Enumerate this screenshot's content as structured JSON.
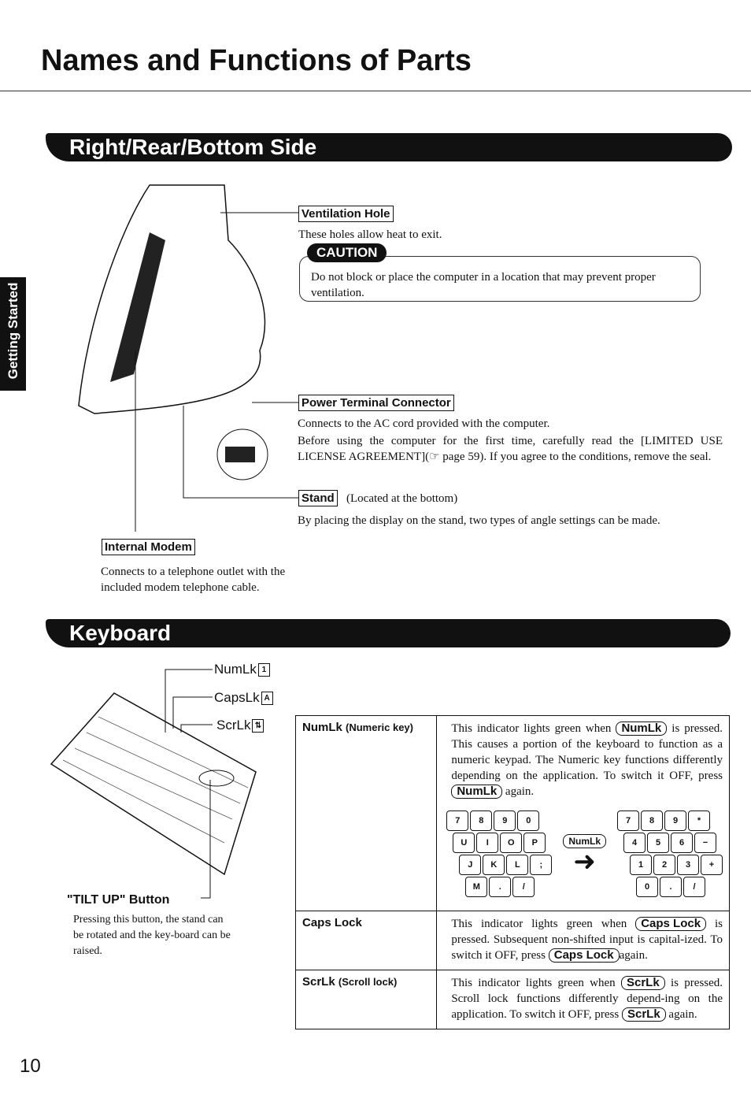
{
  "title": "Names and Functions of Parts",
  "side_tab": "Getting Started",
  "page_number": "10",
  "section1": {
    "heading": "Right/Rear/Bottom Side",
    "ventilation": {
      "label": "Ventilation Hole",
      "text": "These holes allow heat to exit."
    },
    "caution": {
      "badge": "CAUTION",
      "text": "Do not block or place the computer in a location that may prevent proper ventilation."
    },
    "power": {
      "label": "Power Terminal Connector",
      "text1": "Connects to the AC cord provided with the computer.",
      "text2": "Before using the computer for the first time, carefully read the [LIMITED USE LICENSE  AGREEMENT](☞ page 59).  If you agree to the conditions, remove the seal."
    },
    "stand": {
      "label": "Stand",
      "note": "(Located at the bottom)",
      "text": "By placing the display on the stand, two types of angle settings can be made."
    },
    "modem": {
      "label": "Internal Modem",
      "text": "Connects to a telephone outlet with the included modem telephone cable."
    }
  },
  "section2": {
    "heading": "Keyboard",
    "indicators": {
      "numlk": "NumLk",
      "numlk_icon": "1",
      "capslk": "CapsLk",
      "capslk_icon": "A",
      "scrlk": "ScrLk",
      "scrlk_icon": "⇅"
    },
    "tilt": {
      "label": "\"TILT UP\" Button",
      "text": "Pressing this button, the stand can be rotated and the key-board can be raised."
    },
    "rows": [
      {
        "name": "NumLk",
        "sub": "(Numeric key)",
        "pre": "This indicator lights green when",
        "key": "NumLk",
        "mid": "is pressed.  This causes a portion of the keyboard to function as a numeric keypad.  The  Numeric key functions differently depending on the application. To switch it OFF, press",
        "key2": "NumLk",
        "post": "again."
      },
      {
        "name": "Caps Lock",
        "sub": "",
        "pre": "This indicator lights green when",
        "key": "Caps Lock",
        "mid": "is pressed.  Subsequent non-shifted input is capital-ized. To switch it OFF, press",
        "key2": "Caps Lock",
        "post": "again."
      },
      {
        "name": "ScrLk",
        "sub": "(Scroll lock)",
        "pre": "This indicator lights green when",
        "key": "ScrLk",
        "mid": "is pressed.  Scroll lock functions differently depend-ing on the application.  To switch it OFF, press",
        "key2": "ScrLk",
        "post": "again."
      }
    ],
    "keypad_left": [
      [
        "7",
        "8",
        "9",
        "0"
      ],
      [
        "U",
        "I",
        "O",
        "P"
      ],
      [
        "J",
        "K",
        "L",
        ";"
      ],
      [
        "M",
        ".",
        "/"
      ]
    ],
    "keypad_key": "NumLk",
    "keypad_right": [
      [
        "7",
        "8",
        "9",
        "*"
      ],
      [
        "4",
        "5",
        "6",
        "−"
      ],
      [
        "1",
        "2",
        "3",
        "+"
      ],
      [
        "0",
        ".",
        "/"
      ]
    ]
  }
}
